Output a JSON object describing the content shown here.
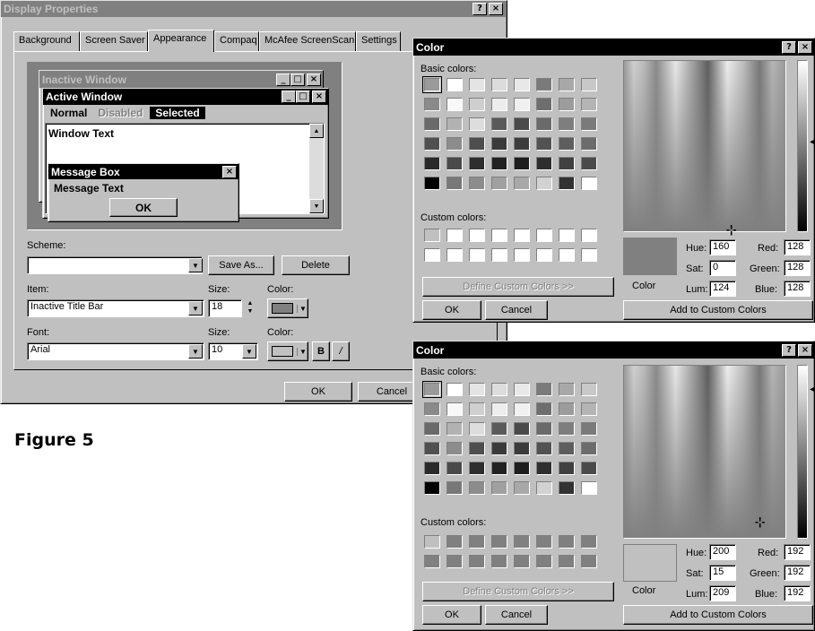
{
  "display_properties": {
    "title": "Display Properties",
    "help_btn": "?",
    "close_btn": "×",
    "tabs": [
      "Background",
      "Screen Saver",
      "Appearance",
      "Compaq",
      "McAfee ScreenScan",
      "Settings"
    ],
    "preview": {
      "inactive_title": "Inactive Window",
      "active_title": "Active Window",
      "menu_normal": "Normal",
      "menu_disabled": "Disabled",
      "menu_selected": "Selected",
      "window_text": "Window Text",
      "msgbox_title": "Message Box",
      "msgbox_text": "Message Text",
      "msgbox_ok": "OK",
      "min_btn": "_",
      "max_btn": "□",
      "close_btn": "×"
    },
    "scheme_label": "Scheme:",
    "scheme_value": "",
    "save_as_label": "Save As...",
    "delete_label": "Delete",
    "item_label": "Item:",
    "item_value": "Inactive Title Bar",
    "item_size_label": "Size:",
    "item_size_value": "18",
    "item_color_label": "Color:",
    "font_label": "Font:",
    "font_value": "Arial",
    "font_size_label": "Size:",
    "font_size_value": "10",
    "font_color_label": "Color:",
    "bold_label": "B",
    "italic_label": "/",
    "ok_label": "OK",
    "cancel_label": "Cancel"
  },
  "figure_caption": "Figure 5",
  "color_dialogs": [
    {
      "title": "Color",
      "help_btn": "?",
      "close_btn": "×",
      "basic_colors_label": "Basic colors:",
      "basic_colors": [
        "#9a9a9a",
        "#ffffff",
        "#e4e4e4",
        "#dcdcdc",
        "#e8e8e8",
        "#7a7a7a",
        "#a8a8a8",
        "#c8c8c8",
        "#8a8a8a",
        "#f8f8f8",
        "#cfcfcf",
        "#ededed",
        "#f0f0f0",
        "#6e6e6e",
        "#9c9c9c",
        "#b4b4b4",
        "#6a6a6a",
        "#b2b2b2",
        "#dddddd",
        "#5a5a5a",
        "#4a4a4a",
        "#6a6a6a",
        "#7e7e7e",
        "#7a7a7a",
        "#505050",
        "#8c8c8c",
        "#4e4e4e",
        "#3a3a3a",
        "#3c3c3c",
        "#525252",
        "#5e5e5e",
        "#6c6c6c",
        "#2a2a2a",
        "#4a4a4a",
        "#2e2e2e",
        "#222222",
        "#1e1e1e",
        "#2e2e2e",
        "#404040",
        "#4a4a4a",
        "#000000",
        "#787878",
        "#8c8c8c",
        "#a0a0a0",
        "#a8a8a8",
        "#d2d2d2",
        "#323232",
        "#ffffff"
      ],
      "custom_colors_label": "Custom colors:",
      "custom_colors": [
        "#c0c0c0",
        "#ffffff",
        "#ffffff",
        "#ffffff",
        "#ffffff",
        "#ffffff",
        "#ffffff",
        "#ffffff",
        "#ffffff",
        "#ffffff",
        "#ffffff",
        "#ffffff",
        "#ffffff",
        "#ffffff",
        "#ffffff",
        "#ffffff"
      ],
      "define_custom_label": "Define Custom Colors >>",
      "ok_label": "OK",
      "cancel_label": "Cancel",
      "preview_color": "#808080",
      "color_solid_label": "Color",
      "hue_label": "Hue:",
      "hue_value": "160",
      "sat_label": "Sat:",
      "sat_value": "0",
      "lum_label": "Lum:",
      "lum_value": "124",
      "red_label": "Red:",
      "red_value": "128",
      "green_label": "Green:",
      "green_value": "128",
      "blue_label": "Blue:",
      "blue_value": "128",
      "add_custom_label": "Add to Custom Colors"
    },
    {
      "title": "Color",
      "help_btn": "?",
      "close_btn": "×",
      "basic_colors_label": "Basic colors:",
      "basic_colors": [
        "#9a9a9a",
        "#ffffff",
        "#e4e4e4",
        "#dcdcdc",
        "#e8e8e8",
        "#7a7a7a",
        "#a8a8a8",
        "#c8c8c8",
        "#8a8a8a",
        "#f8f8f8",
        "#cfcfcf",
        "#ededed",
        "#f0f0f0",
        "#6e6e6e",
        "#9c9c9c",
        "#b4b4b4",
        "#6a6a6a",
        "#b2b2b2",
        "#dddddd",
        "#5a5a5a",
        "#4a4a4a",
        "#6a6a6a",
        "#7e7e7e",
        "#7a7a7a",
        "#505050",
        "#8c8c8c",
        "#4e4e4e",
        "#3a3a3a",
        "#3c3c3c",
        "#525252",
        "#5e5e5e",
        "#6c6c6c",
        "#2a2a2a",
        "#4a4a4a",
        "#2e2e2e",
        "#222222",
        "#1e1e1e",
        "#2e2e2e",
        "#404040",
        "#4a4a4a",
        "#000000",
        "#787878",
        "#8c8c8c",
        "#a0a0a0",
        "#a8a8a8",
        "#d2d2d2",
        "#323232",
        "#ffffff"
      ],
      "custom_colors_label": "Custom colors:",
      "custom_colors": [
        "#c0c0c0",
        "#808080",
        "#808080",
        "#808080",
        "#808080",
        "#808080",
        "#808080",
        "#808080",
        "#808080",
        "#808080",
        "#808080",
        "#808080",
        "#808080",
        "#808080",
        "#808080",
        "#808080"
      ],
      "define_custom_label": "Define Custom Colors >>",
      "ok_label": "OK",
      "cancel_label": "Cancel",
      "preview_color": "#c0c0c0",
      "color_solid_label": "Color",
      "hue_label": "Hue:",
      "hue_value": "200",
      "sat_label": "Sat:",
      "sat_value": "15",
      "lum_label": "Lum:",
      "lum_value": "209",
      "red_label": "Red:",
      "red_value": "192",
      "green_label": "Green:",
      "green_value": "192",
      "blue_label": "Blue:",
      "blue_value": "192",
      "add_custom_label": "Add to Custom Colors"
    }
  ]
}
